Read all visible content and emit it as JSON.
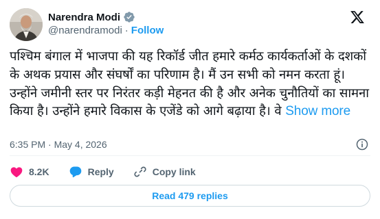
{
  "author": {
    "display_name": "Narendra Modi",
    "handle": "@narendramodi",
    "separator": "·",
    "follow_label": "Follow",
    "verified_color": "#1d9bf0"
  },
  "tweet": {
    "text": "पश्चिम बंगाल में भाजपा की यह रिकॉर्ड जीत हमारे कर्मठ कार्यकर्ताओं के दशकों के अथक प्रयास और संघर्षों का परिणाम है। मैं उन सभी को नमन करता हूं। उन्होंने जमीनी स्तर पर निरंतर कड़ी मेहनत की है और अनेक चुनौतियों का सामना किया है। उन्होंने हमारे विकास के एजेंडे को आगे बढ़ाया है। वे",
    "show_more_label": "Show more",
    "timestamp": "6:35 PM · May 4, 2026"
  },
  "actions": {
    "likes": "8.2K",
    "reply_label": "Reply",
    "copy_link_label": "Copy link"
  },
  "replies_button_label": "Read 479 replies",
  "icons": {
    "logo": "x-logo-icon",
    "verified": "verified-badge-icon",
    "info": "info-icon",
    "like": "heart-icon",
    "reply": "reply-bubble-icon",
    "copy": "link-icon"
  },
  "colors": {
    "accent": "#1d9bf0",
    "like": "#f91880",
    "muted": "#536471"
  }
}
